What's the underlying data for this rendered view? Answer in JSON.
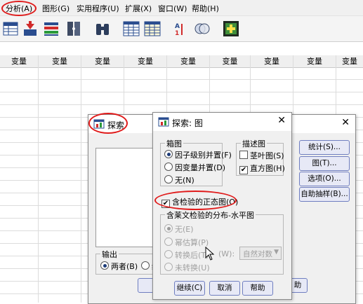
{
  "menubar": {
    "items": [
      {
        "label": "分析(A)"
      },
      {
        "label": "图形(G)"
      },
      {
        "label": "实用程序(U)"
      },
      {
        "label": "扩展(X)"
      },
      {
        "label": "窗口(W)"
      },
      {
        "label": "帮助(H)"
      }
    ]
  },
  "toolbar": {
    "icons": [
      "table-chart-icon",
      "import-arrow-icon",
      "variable-list-icon",
      "split-file-icon",
      "binoculars-icon",
      "grid-table-icon",
      "value-labels-icon",
      "weight-cases-icon",
      "venn-circles-icon",
      "plus-square-icon"
    ],
    "weight_icon_label": "A"
  },
  "grid": {
    "column_header": "变量",
    "columns": [
      "变量",
      "变量",
      "变量",
      "变量",
      "变量",
      "变量",
      "变量",
      "变量",
      "变量"
    ]
  },
  "explore_dialog": {
    "title": "探索",
    "buttons": {
      "stats": "统计(S)...",
      "plots": "图(T)...",
      "options": "选项(O)...",
      "bootstrap": "自助抽样(B)..."
    },
    "output_group": "输出",
    "output_both": "两者(B)",
    "output_cut": "统",
    "bottom_cut_left": "确",
    "bottom_cut_right": "助"
  },
  "plots_dialog": {
    "title": "探索: 图",
    "boxplot_group": "箱图",
    "boxplot_options": [
      {
        "label": "因子级别并置(F)",
        "selected": true
      },
      {
        "label": "因变量并置(D)",
        "selected": false
      },
      {
        "label": "无(N)",
        "selected": false
      }
    ],
    "descriptive_group": "描述图",
    "stem_leaf": "茎叶图(S)",
    "stem_leaf_checked": false,
    "histogram": "直方图(H)",
    "histogram_checked": true,
    "normality": "含检验的正态图(O)",
    "normality_checked": true,
    "spread_group": "含莱文检验的分布-水平图",
    "spread_options": [
      {
        "label": "无(E)",
        "selected": true
      },
      {
        "label": "幂估算(P)",
        "selected": false
      },
      {
        "label": "转换后(T)",
        "selected": false
      },
      {
        "label": "未转换(U)",
        "selected": false
      }
    ],
    "power_label": "(W):",
    "power_value": "自然对数",
    "buttons": {
      "continue": "继续(C)",
      "cancel": "取消",
      "help": "帮助"
    }
  },
  "colors": {
    "highlight_oval": "#e01b1b",
    "button_border": "#6f7ec0",
    "button_fill": "#e7e9f6"
  }
}
